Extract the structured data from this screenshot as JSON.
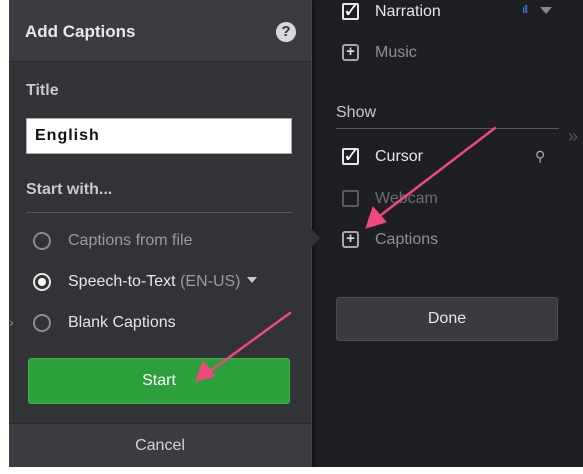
{
  "dialog": {
    "title": "Add Captions",
    "help_icon": "?",
    "title_section_label": "Title",
    "title_value": "English",
    "start_with_label": "Start with...",
    "options": [
      {
        "label": "Captions from file",
        "selected": false
      },
      {
        "label": "Speech-to-Text",
        "language": "(EN-US)",
        "selected": true
      },
      {
        "label": "Blank Captions",
        "selected": false
      }
    ],
    "start_label": "Start",
    "cancel_label": "Cancel"
  },
  "panel": {
    "narration_label": "Narration",
    "music_label": "Music",
    "show_label": "Show",
    "cursor_label": "Cursor",
    "webcam_label": "Webcam",
    "captions_label": "Captions",
    "done_label": "Done",
    "icons": {
      "levels": "ıll",
      "cursor_effects": "⚲",
      "expand": "»",
      "left_chevron": "›"
    }
  },
  "colors": {
    "background": "#1e1f22",
    "dialog": "#323337",
    "start_green": "#2ca03a",
    "annotation_arrow": "#f0487c",
    "levels_blue": "#3f7bd9"
  }
}
